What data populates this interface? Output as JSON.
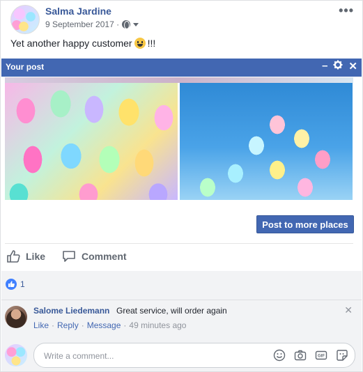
{
  "post": {
    "author": "Salma Jardine",
    "date": "9 September 2017 ·",
    "text_before": "Yet another happy customer",
    "text_after": "!!!"
  },
  "panel": {
    "title": "Your post"
  },
  "actions": {
    "post_more": "Post to more places",
    "like": "Like",
    "comment": "Comment"
  },
  "reactions": {
    "count": "1"
  },
  "comment": {
    "author": "Salome Liedemann",
    "text": "Great service, will order again",
    "like": "Like",
    "reply": "Reply",
    "message": "Message",
    "dot": "·",
    "time": "49 minutes ago"
  },
  "composer": {
    "placeholder": "Write a comment..."
  },
  "colors": {
    "brand": "#4267b2",
    "link": "#385898"
  }
}
